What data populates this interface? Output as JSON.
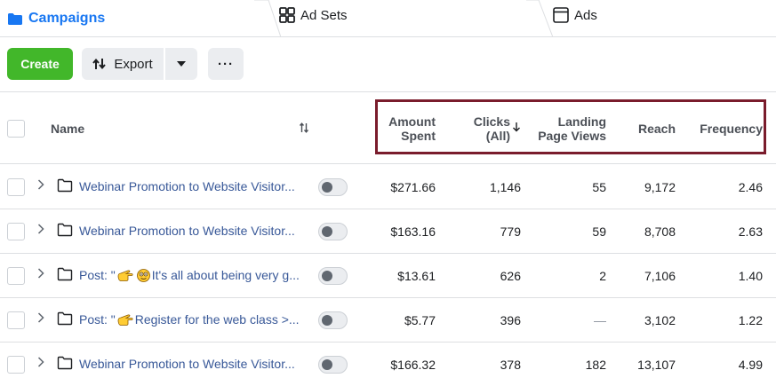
{
  "tabs": {
    "campaigns": "Campaigns",
    "adsets": "Ad Sets",
    "ads": "Ads"
  },
  "toolbar": {
    "create_label": "Create",
    "export_label": "Export",
    "more_label": "···"
  },
  "columns": {
    "name": "Name",
    "amount_spent_1": "Amount",
    "amount_spent_2": "Spent",
    "clicks_1": "Clicks",
    "clicks_2": "(All)",
    "lpv_1": "Landing",
    "lpv_2": "Page Views",
    "reach": "Reach",
    "frequency": "Frequency"
  },
  "rows": [
    {
      "name_pre": "Webinar Promotion to Website Visitor...",
      "name_post": "",
      "amount": "$271.66",
      "clicks": "1,146",
      "lpv": "55",
      "reach": "9,172",
      "frequency": "2.46"
    },
    {
      "name_pre": "Webinar Promotion to Website Visitor...",
      "name_post": "",
      "amount": "$163.16",
      "clicks": "779",
      "lpv": "59",
      "reach": "8,708",
      "frequency": "2.63"
    },
    {
      "name_pre": "Post: \"",
      "name_post": " It's all about being very g...",
      "amount": "$13.61",
      "clicks": "626",
      "lpv": "2",
      "reach": "7,106",
      "frequency": "1.40"
    },
    {
      "name_pre": "Post: \"",
      "name_post": " Register for the web class >...",
      "amount": "$5.77",
      "clicks": "396",
      "lpv": "—",
      "reach": "3,102",
      "frequency": "1.22"
    },
    {
      "name_pre": "Webinar Promotion to Website Visitor...",
      "name_post": "",
      "amount": "$166.32",
      "clicks": "378",
      "lpv": "182",
      "reach": "13,107",
      "frequency": "4.99"
    }
  ],
  "colors": {
    "accent": "#1877f2",
    "create": "#42b72a",
    "highlight": "#7a1c2c",
    "link": "#385898"
  }
}
